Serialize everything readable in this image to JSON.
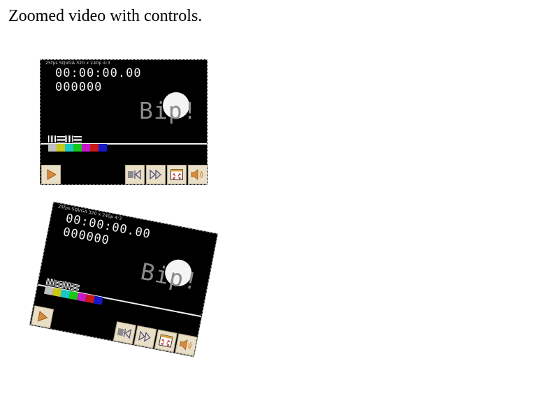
{
  "page": {
    "heading": "Zoomed video with controls."
  },
  "video": {
    "osd_info": "25fps SQVGA 320 x 240p 4:3",
    "timecode": "00:00:00.00",
    "frame_count": "000000",
    "bip_text": "Bip!",
    "color_bars": [
      "#c0c0c0",
      "#c8c818",
      "#18c8c8",
      "#18c818",
      "#c818c8",
      "#c81818",
      "#1818c8"
    ]
  },
  "controls": {
    "play": "play-icon",
    "rewind": "rewind-icon",
    "fast_forward": "fast-forward-icon",
    "fullscreen": "fullscreen-icon",
    "volume": "volume-icon",
    "accent": "#d88a3a",
    "button_bg": "#e8dfc6"
  }
}
